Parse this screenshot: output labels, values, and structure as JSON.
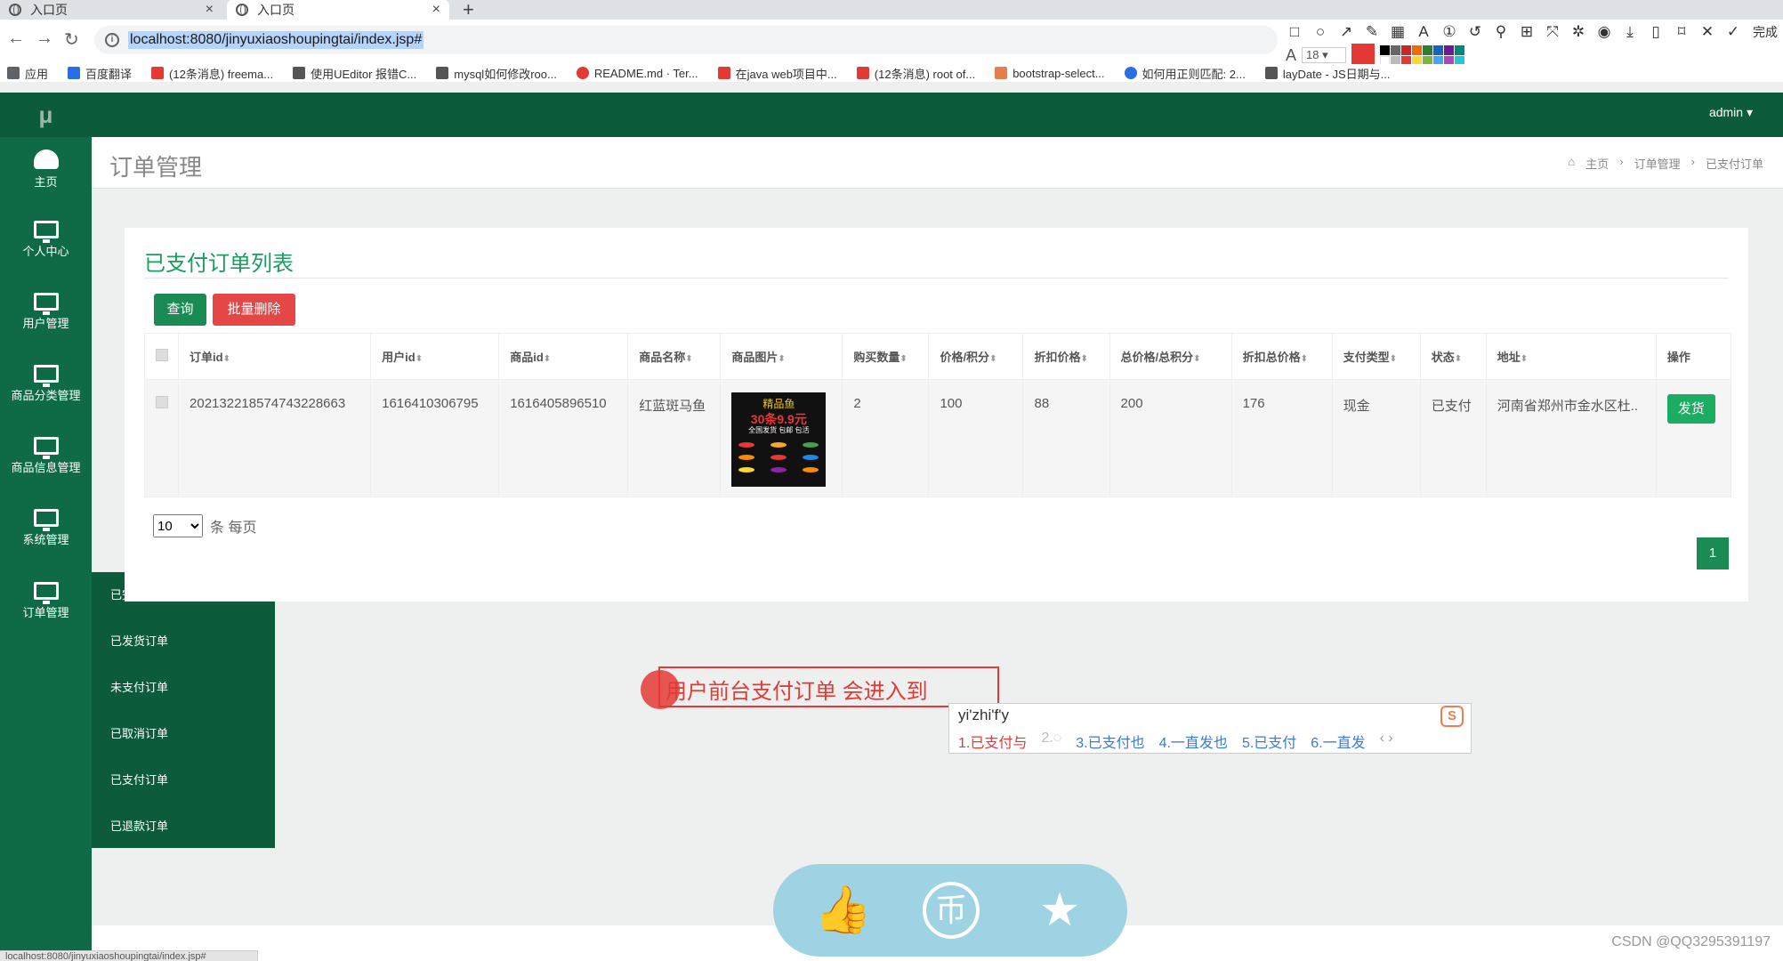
{
  "browser": {
    "tabs": [
      {
        "title": "入口页",
        "active": false
      },
      {
        "title": "入口页",
        "active": true
      }
    ],
    "url": "localhost:8080/jinyuxiaoshoupingtai/index.jsp#",
    "font_size": "18",
    "done_label": "完成",
    "bookmarks": [
      {
        "label": "应用",
        "color": "#5f6368"
      },
      {
        "label": "百度翻译",
        "color": "#2b6de5"
      },
      {
        "label": "(12条消息) freema...",
        "color": "#e53935"
      },
      {
        "label": "使用UEditor 报错C...",
        "color": "#555555"
      },
      {
        "label": "mysql如何修改roo...",
        "color": "#555555"
      },
      {
        "label": "README.md · Ter...",
        "color": "#e53935"
      },
      {
        "label": "在java web项目中...",
        "color": "#e53935"
      },
      {
        "label": "(12条消息) root of...",
        "color": "#e53935"
      },
      {
        "label": "bootstrap-select...",
        "color": "#e57f4d"
      },
      {
        "label": "如何用正则匹配: 2...",
        "color": "#2b6de5"
      },
      {
        "label": "layDate - JS日期与...",
        "color": "#555555"
      }
    ]
  },
  "header": {
    "logo": "μ",
    "user": "admin ▾"
  },
  "sidebar": {
    "items": [
      {
        "label": "主页",
        "icon": "dashboard-icon"
      },
      {
        "label": "个人中心",
        "icon": "monitor-icon"
      },
      {
        "label": "用户管理",
        "icon": "monitor-icon"
      },
      {
        "label": "商品分类管理",
        "icon": "monitor-icon"
      },
      {
        "label": "商品信息管理",
        "icon": "monitor-icon"
      },
      {
        "label": "系统管理",
        "icon": "monitor-icon"
      },
      {
        "label": "订单管理",
        "icon": "monitor-icon"
      }
    ],
    "submenu": [
      "已完成订单",
      "已发货订单",
      "未支付订单",
      "已取消订单",
      "已支付订单",
      "已退款订单"
    ]
  },
  "page": {
    "title": "订单管理",
    "breadcrumb": [
      "主页",
      "订单管理",
      "已支付订单"
    ]
  },
  "card": {
    "title": "已支付订单列表",
    "btn_query": "查询",
    "btn_batch_delete": "批量删除",
    "columns": [
      "订单id",
      "用户id",
      "商品id",
      "商品名称",
      "商品图片",
      "购买数量",
      "价格/积分",
      "折扣价格",
      "总价格/总积分",
      "折扣总价格",
      "支付类型",
      "状态",
      "地址",
      "操作"
    ],
    "rows": [
      {
        "order_id": "20213221857474322866​3",
        "user_id": "1616410306795",
        "product_id": "1616405896510",
        "product_name": "红蓝斑马鱼",
        "quantity": "2",
        "price": "100",
        "discount_price": "88",
        "total": "200",
        "discount_total": "176",
        "pay_type": "现金",
        "status": "已支付",
        "address": "河南省郑州市金水区杜..",
        "action": "发货",
        "image_text": [
          "精品鱼",
          "30条9.9元",
          "全国发货 包邮 包活"
        ]
      }
    ],
    "page_size": "10",
    "page_size_suffix": "条 每页",
    "current_page": "1"
  },
  "annotation": {
    "text": "用户前台支付订单  会进入到"
  },
  "ime": {
    "composition": "yi'zhi'f'y",
    "candidates": [
      "1.已支付与",
      "2.◌",
      "3.已支付也",
      "4.一直发也",
      "5.已支付",
      "6.一直发",
      "‹ ›"
    ]
  },
  "watermark": "CSDN @QQ3295391197",
  "status_url": "localhost:8080/jinyuxiaoshoupingtai/index.jsp#"
}
